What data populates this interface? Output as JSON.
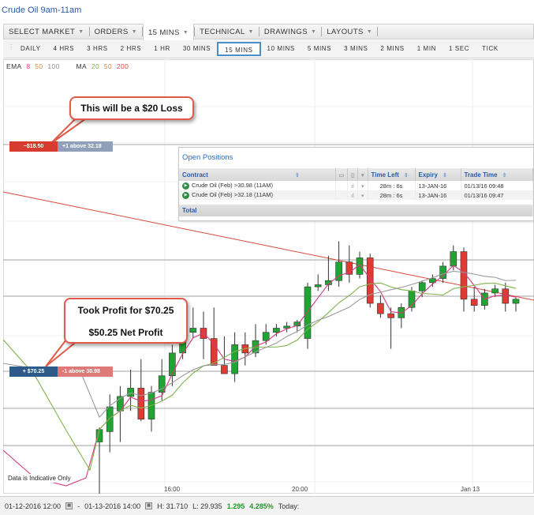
{
  "window": {
    "title": "Crude Oil 9am-11am"
  },
  "menu": [
    {
      "label": "SELECT MARKET",
      "active": false
    },
    {
      "label": "ORDERS",
      "active": false
    },
    {
      "label": "15 MINS",
      "active": true
    },
    {
      "label": "TECHNICAL",
      "active": false
    },
    {
      "label": "DRAWINGS",
      "active": false
    },
    {
      "label": "LAYOUTS",
      "active": false
    }
  ],
  "timeframes": [
    "DAILY",
    "4 HRS",
    "3 HRS",
    "2 HRS",
    "1 HR",
    "30 MINS",
    "15 MINS",
    "10 MINS",
    "5 MINS",
    "3 MINS",
    "2 MINS",
    "1 MIN",
    "1 SEC",
    "TICK"
  ],
  "selected_timeframe": "15 MINS",
  "legend": {
    "ema_label": "EMA",
    "ema": [
      "8",
      "50",
      "100"
    ],
    "ma_label": "MA",
    "ma": [
      "20",
      "50",
      "200"
    ],
    "ema_colors": [
      "#d23b7e",
      "#5aa83a",
      "#8a8a8a"
    ],
    "ma_colors": [
      "#7fb34d",
      "#5aa83a",
      "#d9473b"
    ]
  },
  "callouts": {
    "loss": "This will be a $20 Loss",
    "profit_1": "Took Profit for $70.25",
    "profit_2": "$50.25 Net Profit"
  },
  "order_tags": {
    "stop": {
      "amount": "−$18.50",
      "detail": "+1 above 32.18"
    },
    "limit": {
      "amount": "+ $70.25",
      "detail": "-1 above 30.98"
    }
  },
  "positions": {
    "title": "Open Positions",
    "columns": [
      "Contract",
      "Time Left",
      "Expiry",
      "Trade Time"
    ],
    "rows": [
      {
        "contract": "Crude Oil (Feb) >30.98 (11AM)",
        "time_left": "28m : 6s",
        "expiry": "13-JAN-16",
        "trade_time": "01/13/16 09:48"
      },
      {
        "contract": "Crude Oil (Feb) >32.18 (11AM)",
        "time_left": "28m : 6s",
        "expiry": "13-JAN-16",
        "trade_time": "01/13/16 09:47"
      }
    ],
    "total_label": "Total"
  },
  "chart_data": {
    "type": "candlestick",
    "x_labels": [
      "16:00",
      "20:00",
      "Jan 13"
    ],
    "candles": [
      {
        "o": 30.55,
        "h": 30.62,
        "l": 30.3,
        "c": 30.61
      },
      {
        "o": 30.6,
        "h": 30.78,
        "l": 30.5,
        "c": 30.72
      },
      {
        "o": 30.7,
        "h": 30.82,
        "l": 30.55,
        "c": 30.77
      },
      {
        "o": 30.77,
        "h": 30.9,
        "l": 30.7,
        "c": 30.81
      },
      {
        "o": 30.81,
        "h": 30.95,
        "l": 30.65,
        "c": 30.66
      },
      {
        "o": 30.66,
        "h": 30.82,
        "l": 30.6,
        "c": 30.79
      },
      {
        "o": 30.79,
        "h": 30.95,
        "l": 30.75,
        "c": 30.87
      },
      {
        "o": 30.87,
        "h": 31.02,
        "l": 30.82,
        "c": 30.98
      },
      {
        "o": 30.98,
        "h": 31.12,
        "l": 30.95,
        "c": 31.08
      },
      {
        "o": 31.08,
        "h": 31.2,
        "l": 31.05,
        "c": 31.1
      },
      {
        "o": 31.1,
        "h": 31.18,
        "l": 30.95,
        "c": 31.05
      },
      {
        "o": 31.05,
        "h": 31.2,
        "l": 30.95,
        "c": 30.92
      },
      {
        "o": 30.92,
        "h": 31.06,
        "l": 30.88,
        "c": 30.88
      },
      {
        "o": 30.88,
        "h": 31.08,
        "l": 30.84,
        "c": 31.02
      },
      {
        "o": 31.02,
        "h": 31.08,
        "l": 30.92,
        "c": 30.98
      },
      {
        "o": 30.98,
        "h": 31.12,
        "l": 30.96,
        "c": 31.04
      },
      {
        "o": 31.04,
        "h": 31.12,
        "l": 31.02,
        "c": 31.08
      },
      {
        "o": 31.08,
        "h": 31.12,
        "l": 31.06,
        "c": 31.1
      },
      {
        "o": 31.1,
        "h": 31.13,
        "l": 31.08,
        "c": 31.11
      },
      {
        "o": 31.11,
        "h": 31.14,
        "l": 31.08,
        "c": 31.13
      },
      {
        "o": 31.05,
        "h": 31.32,
        "l": 31.0,
        "c": 31.3
      },
      {
        "o": 31.3,
        "h": 31.36,
        "l": 31.28,
        "c": 31.31
      },
      {
        "o": 31.31,
        "h": 31.45,
        "l": 31.28,
        "c": 31.33
      },
      {
        "o": 31.33,
        "h": 31.52,
        "l": 31.3,
        "c": 31.42
      },
      {
        "o": 31.42,
        "h": 31.5,
        "l": 31.32,
        "c": 31.36
      },
      {
        "o": 31.36,
        "h": 31.47,
        "l": 31.34,
        "c": 31.44
      },
      {
        "o": 31.44,
        "h": 31.46,
        "l": 31.2,
        "c": 31.22
      },
      {
        "o": 31.22,
        "h": 31.26,
        "l": 31.15,
        "c": 31.17
      },
      {
        "o": 31.17,
        "h": 31.2,
        "l": 31.0,
        "c": 31.15
      },
      {
        "o": 31.15,
        "h": 31.22,
        "l": 31.1,
        "c": 31.2
      },
      {
        "o": 31.2,
        "h": 31.3,
        "l": 31.18,
        "c": 31.28
      },
      {
        "o": 31.28,
        "h": 31.33,
        "l": 31.25,
        "c": 31.32
      },
      {
        "o": 31.32,
        "h": 31.36,
        "l": 31.3,
        "c": 31.34
      },
      {
        "o": 31.34,
        "h": 31.42,
        "l": 31.32,
        "c": 31.4
      },
      {
        "o": 31.4,
        "h": 31.5,
        "l": 31.38,
        "c": 31.47
      },
      {
        "o": 31.47,
        "h": 31.49,
        "l": 31.18,
        "c": 31.24
      },
      {
        "o": 31.24,
        "h": 31.3,
        "l": 31.18,
        "c": 31.21
      },
      {
        "o": 31.21,
        "h": 31.29,
        "l": 31.19,
        "c": 31.27
      },
      {
        "o": 31.27,
        "h": 31.31,
        "l": 31.25,
        "c": 31.29
      },
      {
        "o": 31.29,
        "h": 31.32,
        "l": 31.18,
        "c": 31.22
      },
      {
        "o": 31.22,
        "h": 31.25,
        "l": 31.18,
        "c": 31.24
      }
    ],
    "y_range": [
      30.3,
      32.4
    ],
    "horizontal_levels": [
      32.18,
      30.98
    ]
  },
  "footer": {
    "indicative": "Data is Indicative Only",
    "from": "01-12-2016 12:00",
    "dash": "-",
    "to": "01-13-2016 14:00",
    "high": "H: 31.710",
    "low": "L: 29.935",
    "change": "1.295",
    "change_pct": "4.285%",
    "today": "Today:"
  }
}
